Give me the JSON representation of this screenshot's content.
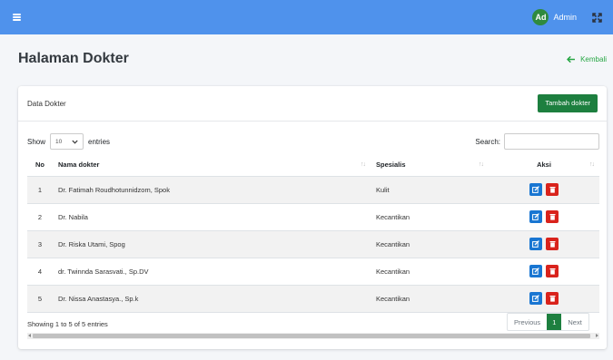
{
  "topbar": {
    "avatar_initials": "Ad",
    "user_name": "Admin"
  },
  "page": {
    "title": "Halaman Dokter",
    "back_label": "Kembali"
  },
  "card": {
    "title": "Data Dokter",
    "add_button": "Tambah dokter",
    "show_label": "Show",
    "entries_label": "entries",
    "page_length": "10",
    "search_label": "Search:"
  },
  "table": {
    "headers": {
      "no": "No",
      "name": "Nama dokter",
      "specialty": "Spesialis",
      "actions": "Aksi"
    },
    "rows": [
      {
        "no": "1",
        "name": "Dr. Fatimah Roudhotunnidzom, Spok",
        "specialty": "Kulit"
      },
      {
        "no": "2",
        "name": "Dr. Nabila",
        "specialty": "Kecantikan"
      },
      {
        "no": "3",
        "name": "Dr. Riska Utami, Spog",
        "specialty": "Kecantikan"
      },
      {
        "no": "4",
        "name": "dr. Twinnda Sarasvati., Sp.DV",
        "specialty": "Kecantikan"
      },
      {
        "no": "5",
        "name": "Dr. Nissa Anastasya., Sp.k",
        "specialty": "Kecantikan"
      }
    ]
  },
  "footer": {
    "info": "Showing 1 to 5 of 5 entries",
    "previous": "Previous",
    "current_page": "1",
    "next": "Next"
  },
  "colors": {
    "navbar": "#4f92ec",
    "primary_green": "#1d7f3f",
    "edit": "#1976d2",
    "delete": "#d9231c"
  },
  "icons": [
    "menu-icon",
    "expand-icon",
    "arrow-left-icon",
    "edit-icon",
    "trash-icon",
    "sort-icon"
  ]
}
